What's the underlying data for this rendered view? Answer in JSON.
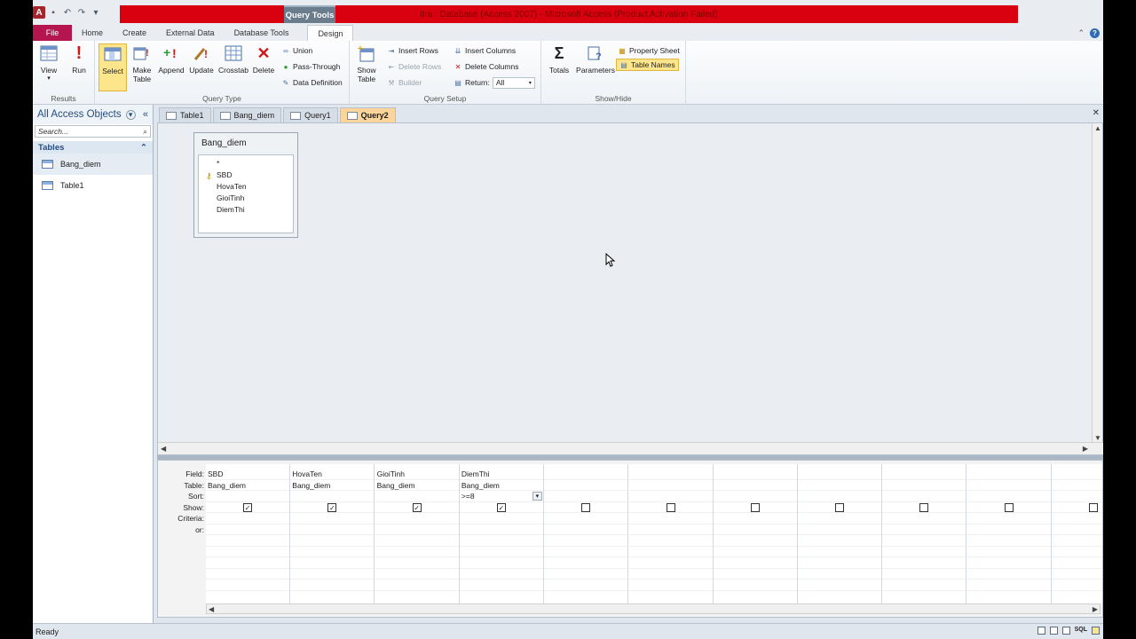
{
  "window": {
    "title": "itra : Database (Access 2007) - Microsoft Access (Product Activation Failed)",
    "context_tab": "Query Tools"
  },
  "quick_access": {
    "app_icon": "A"
  },
  "ribbon_tabs": [
    "File",
    "Home",
    "Create",
    "External Data",
    "Database Tools",
    "Design"
  ],
  "ribbon": {
    "results": {
      "label": "Results",
      "view": "View",
      "run": "Run"
    },
    "query_type": {
      "label": "Query Type",
      "select": "Select",
      "make_table_1": "Make",
      "make_table_2": "Table",
      "append": "Append",
      "update": "Update",
      "crosstab": "Crosstab",
      "delete": "Delete",
      "union": "Union",
      "pass_through": "Pass-Through",
      "data_definition": "Data Definition"
    },
    "query_setup": {
      "label": "Query Setup",
      "show_table_1": "Show",
      "show_table_2": "Table",
      "insert_rows": "Insert Rows",
      "delete_rows": "Delete Rows",
      "builder": "Builder",
      "insert_columns": "Insert Columns",
      "delete_columns": "Delete Columns",
      "return_label": "Return:",
      "return_value": "All"
    },
    "show_hide": {
      "label": "Show/Hide",
      "totals": "Totals",
      "parameters": "Parameters",
      "property_sheet": "Property Sheet",
      "table_names": "Table Names"
    }
  },
  "nav": {
    "title": "All Access Objects",
    "search_placeholder": "Search...",
    "group": "Tables",
    "items": [
      "Bang_diem",
      "Table1"
    ]
  },
  "doc_tabs": [
    "Table1",
    "Bang_diem",
    "Query1",
    "Query2"
  ],
  "table_window": {
    "title": "Bang_diem",
    "fields": [
      "*",
      "SBD",
      "HovaTen",
      "GioiTinh",
      "DiemThi"
    ]
  },
  "grid": {
    "row_labels": [
      "Field:",
      "Table:",
      "Sort:",
      "Show:",
      "Criteria:",
      "or:"
    ],
    "columns": [
      {
        "field": "SBD",
        "table": "Bang_diem",
        "sort": "",
        "show": true
      },
      {
        "field": "HovaTen",
        "table": "Bang_diem",
        "sort": "",
        "show": true
      },
      {
        "field": "GioiTinh",
        "table": "Bang_diem",
        "sort": "",
        "show": true
      },
      {
        "field": "DiemThi",
        "table": "Bang_diem",
        "sort": ">=8",
        "show": true
      },
      {
        "field": "",
        "table": "",
        "sort": "",
        "show": false
      },
      {
        "field": "",
        "table": "",
        "sort": "",
        "show": false
      },
      {
        "field": "",
        "table": "",
        "sort": "",
        "show": false
      },
      {
        "field": "",
        "table": "",
        "sort": "",
        "show": false
      },
      {
        "field": "",
        "table": "",
        "sort": "",
        "show": false
      },
      {
        "field": "",
        "table": "",
        "sort": "",
        "show": false
      },
      {
        "field": "",
        "table": "",
        "sort": "",
        "show": false
      }
    ]
  },
  "status": {
    "text": "Ready",
    "sql_label": "SQL"
  }
}
